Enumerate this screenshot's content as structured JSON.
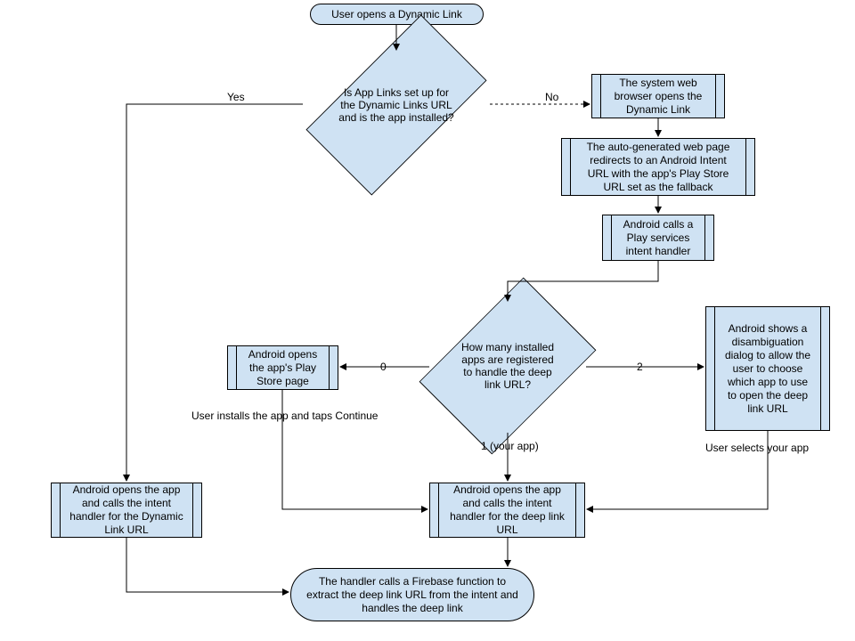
{
  "nodes": {
    "start": "User opens a Dynamic Link",
    "d1": "Is App Links set up for the Dynamic Links URL and is the app installed?",
    "p_browser": "The system web browser opens the Dynamic Link",
    "p_redirect": "The auto-generated web page redirects to an Android Intent URL with the app's Play Store URL set as the fallback",
    "p_playsvc": "Android calls a Play services intent handler",
    "d2": "How many installed apps are registered to handle the deep link URL?",
    "p_playstore": "Android opens the app's Play Store page",
    "p_disambig": "Android shows a disambiguation dialog to allow the user to choose which app to use to open the deep link URL",
    "p_open_dl": "Android opens the app and calls the intent handler for the Dynamic Link URL",
    "p_open_deep": "Android opens the app and calls the intent handler for the deep link URL",
    "end": "The handler calls a Firebase function to extract the deep link URL from the intent and handles the deep link"
  },
  "edges": {
    "yes": "Yes",
    "no": "No",
    "zero": "0",
    "one": "1 (your app)",
    "two": "2",
    "install": "User installs the app and taps Continue",
    "selects": "User selects your app"
  }
}
